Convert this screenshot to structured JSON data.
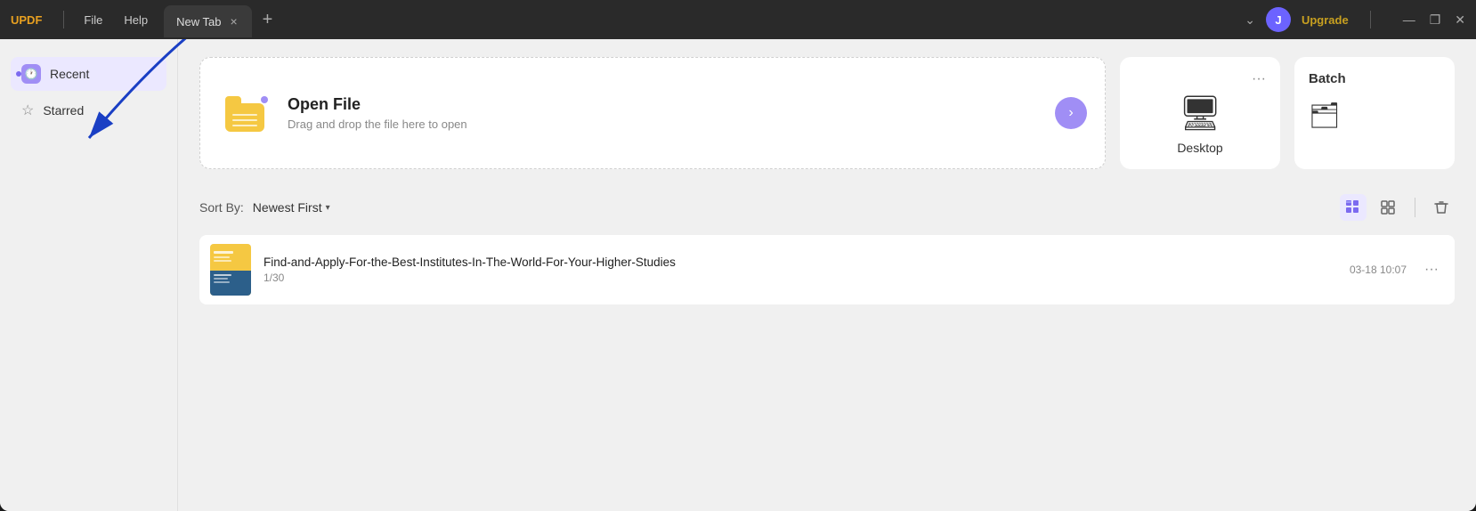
{
  "app": {
    "logo": "UPDF",
    "menu": {
      "file": "File",
      "help": "Help"
    },
    "tab": {
      "label": "New Tab",
      "close": "×"
    },
    "tab_add": "+",
    "upgrade": "Upgrade",
    "user_initial": "J",
    "win_minimize": "—",
    "win_maximize": "❐",
    "win_close": "✕"
  },
  "sidebar": {
    "recent_label": "Recent",
    "starred_label": "Starred"
  },
  "open_file": {
    "title": "Open File",
    "subtitle": "Drag and drop the file here to open",
    "arrow": "›"
  },
  "desktop": {
    "label": "Desktop",
    "more": "···"
  },
  "batch": {
    "label": "Batch"
  },
  "sort": {
    "label": "Sort By:",
    "value": "Newest First",
    "arrow": "▾"
  },
  "view": {
    "grid_active": "⊞",
    "grid_inactive": "⊟",
    "trash": "🗑"
  },
  "files": [
    {
      "name": "Find-and-Apply-For-the-Best-Institutes-In-The-World-For-Your-Higher-Studies",
      "pages": "1/30",
      "date": "03-18 10:07"
    }
  ]
}
